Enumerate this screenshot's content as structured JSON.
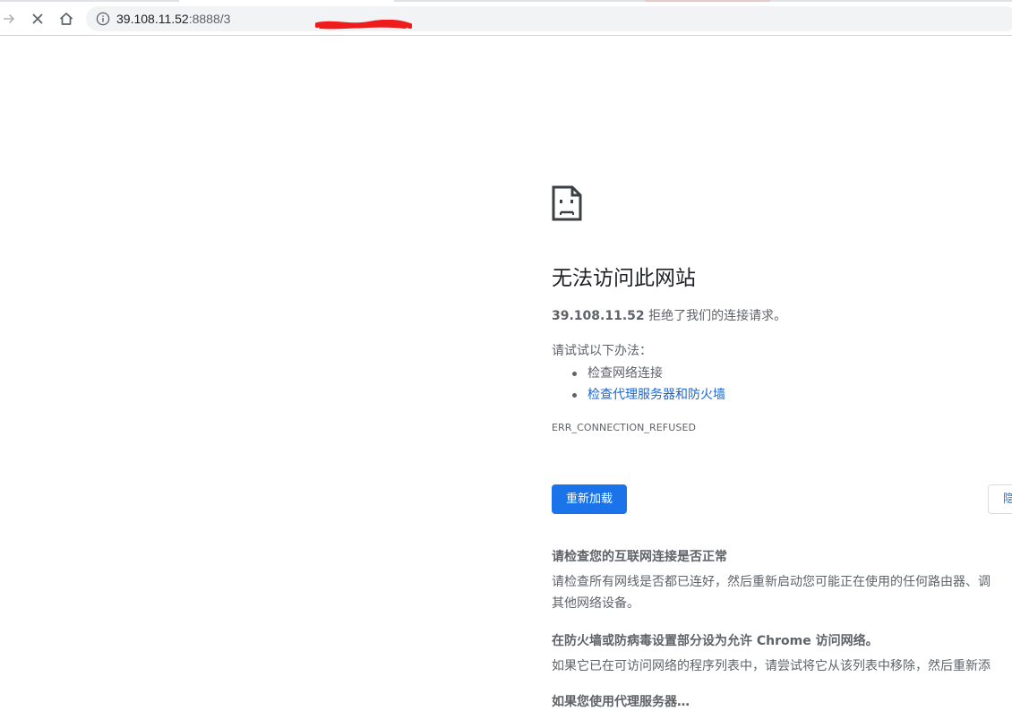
{
  "browser": {
    "url_host": "39.108.11.52",
    "url_rest": ":8888/3",
    "icons": {
      "forward": "forward-arrow-icon",
      "stop": "close-icon",
      "home": "home-icon",
      "site_info": "info-icon"
    }
  },
  "error": {
    "icon": "sad-page-icon",
    "title": "无法访问此网站",
    "summary_host": "39.108.11.52",
    "summary_text": " 拒绝了我们的连接请求。",
    "suggestions_label": "请试试以下办法：",
    "suggestions": [
      "检查网络连接",
      "检查代理服务器和防火墙"
    ],
    "code": "ERR_CONNECTION_REFUSED",
    "reload_label": "重新加载",
    "details_label": "隐",
    "help": [
      {
        "heading": "请检查您的互联网连接是否正常",
        "lines": [
          "请检查所有网线是否都已连好，然后重新启动您可能正在使用的任何路由器、调",
          "其他网络设备。"
        ]
      },
      {
        "heading": "在防火墙或防病毒设置部分设为允许 Chrome 访问网络。",
        "lines": [
          "如果它已在可访问网络的程序列表中，请尝试将它从该列表中移除，然后重新添"
        ]
      },
      {
        "heading": "如果您使用代理服务器…",
        "lines": []
      }
    ]
  },
  "colors": {
    "accent": "#1a73e8",
    "link": "#1967d2",
    "text": "#5f6368",
    "title": "#202124",
    "redaction": "#ee1c1c"
  }
}
